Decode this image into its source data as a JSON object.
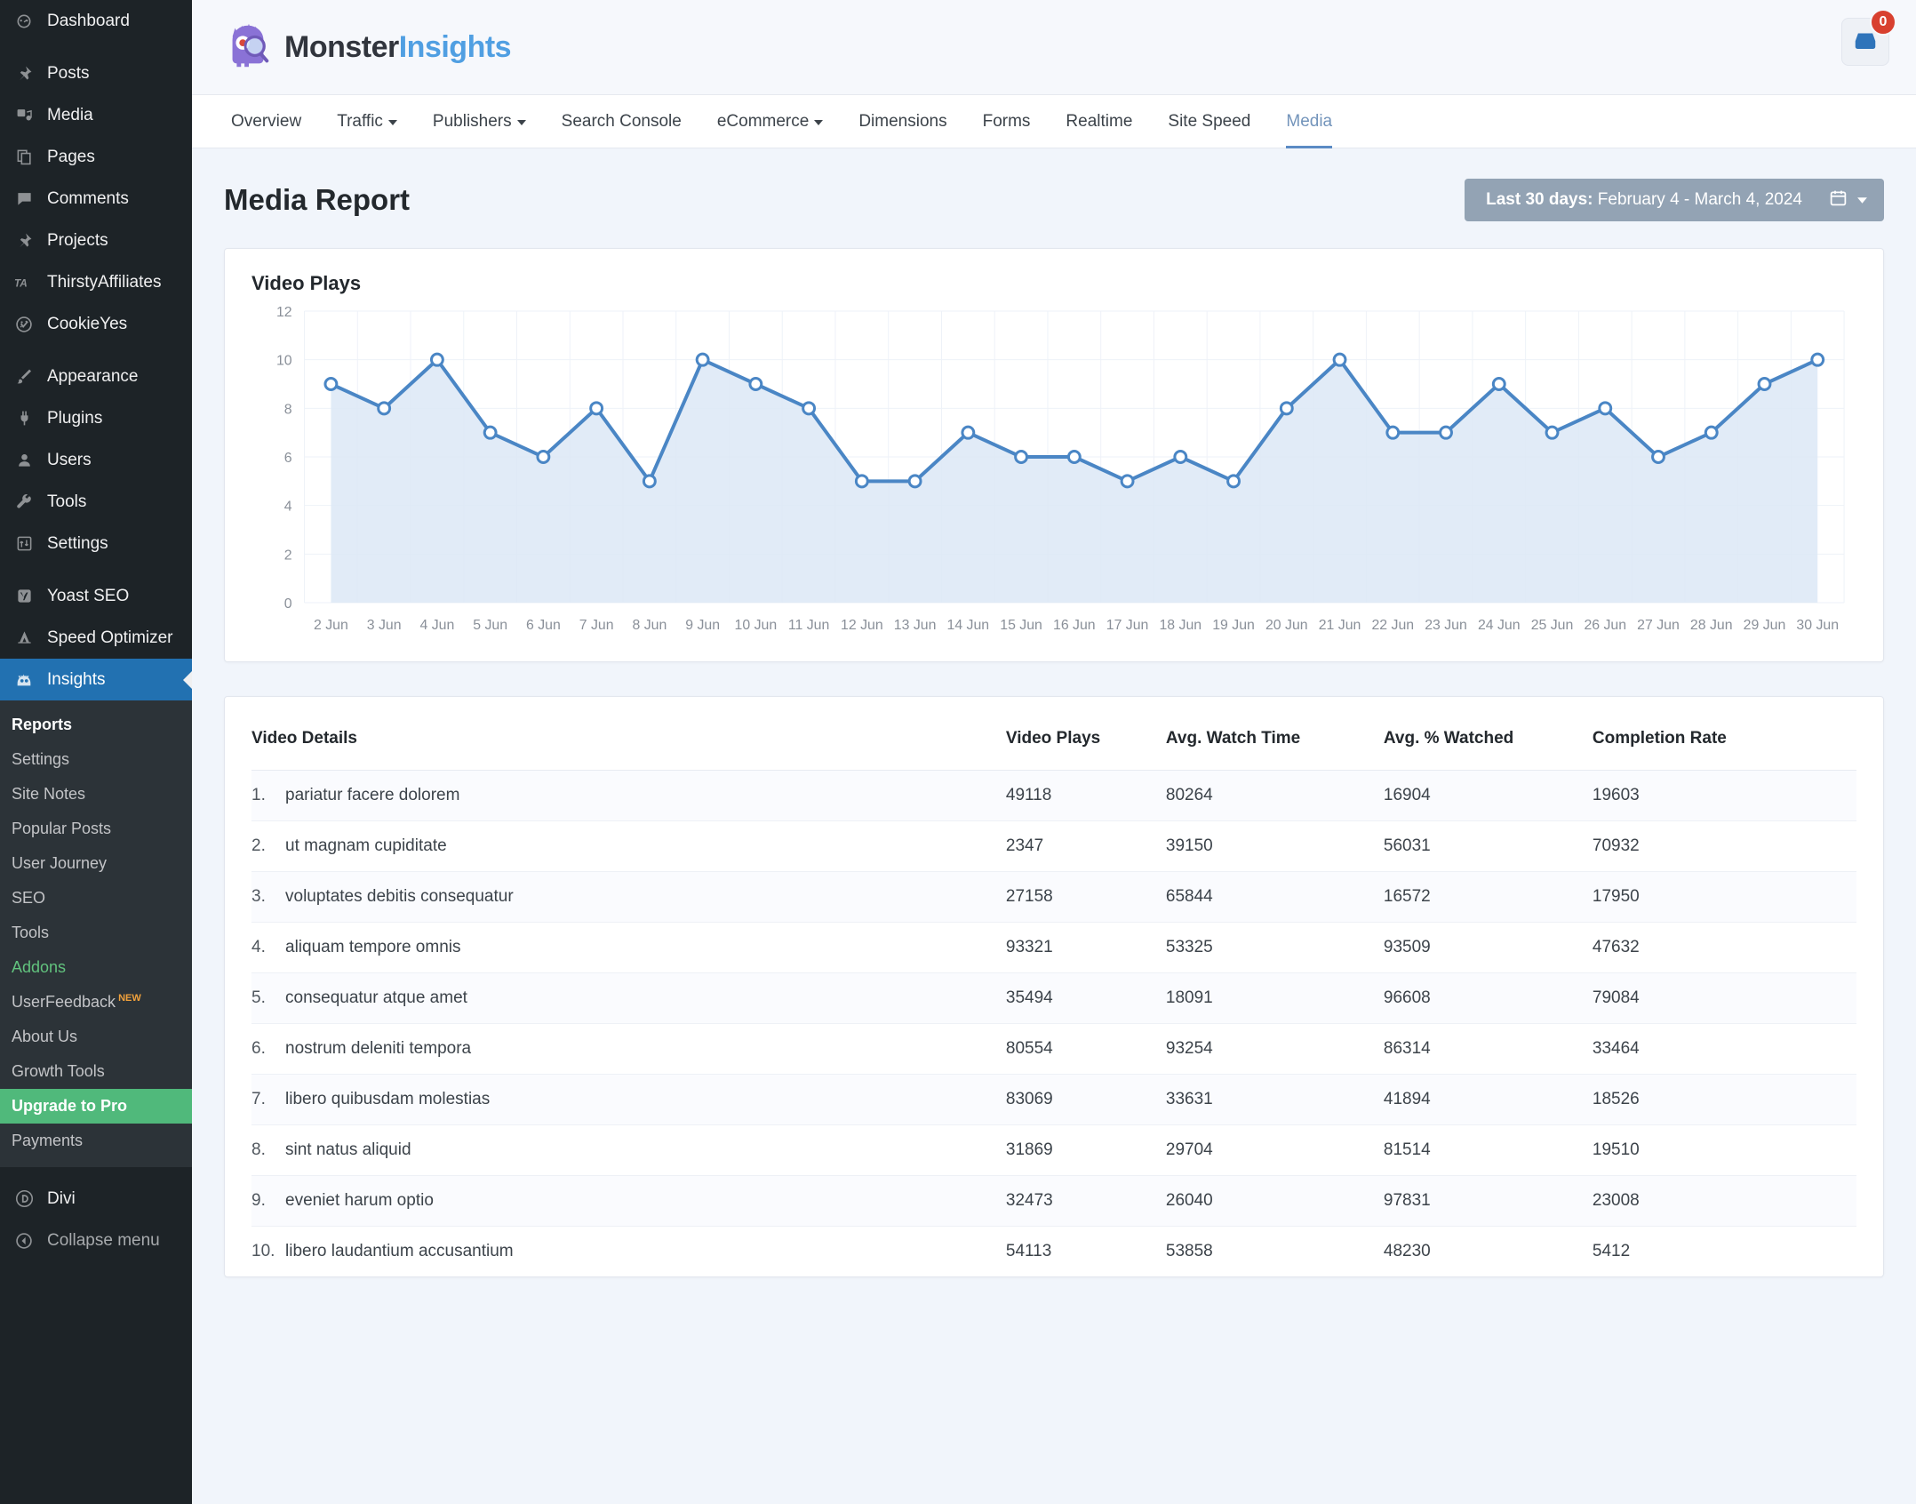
{
  "sidebar": {
    "groups": [
      {
        "items": [
          {
            "label": "Dashboard",
            "icon": "dashboard-icon"
          }
        ]
      },
      {
        "items": [
          {
            "label": "Posts",
            "icon": "pin-icon"
          },
          {
            "label": "Media",
            "icon": "media-icon"
          },
          {
            "label": "Pages",
            "icon": "pages-icon"
          },
          {
            "label": "Comments",
            "icon": "comment-icon"
          },
          {
            "label": "Projects",
            "icon": "pin-icon"
          },
          {
            "label": "ThirstyAffiliates",
            "icon": "thirstyaffiliates-icon"
          },
          {
            "label": "CookieYes",
            "icon": "cookieyes-icon"
          }
        ]
      },
      {
        "items": [
          {
            "label": "Appearance",
            "icon": "brush-icon"
          },
          {
            "label": "Plugins",
            "icon": "plug-icon"
          },
          {
            "label": "Users",
            "icon": "user-icon"
          },
          {
            "label": "Tools",
            "icon": "wrench-icon"
          },
          {
            "label": "Settings",
            "icon": "settings-icon"
          }
        ]
      },
      {
        "items": [
          {
            "label": "Yoast SEO",
            "icon": "yoast-icon"
          },
          {
            "label": "Speed Optimizer",
            "icon": "speed-icon"
          }
        ]
      }
    ],
    "active_item": {
      "label": "Insights",
      "icon": "monsterinsights-icon"
    },
    "submenu": [
      {
        "label": "Reports",
        "state": "current"
      },
      {
        "label": "Settings",
        "state": "normal"
      },
      {
        "label": "Site Notes",
        "state": "normal"
      },
      {
        "label": "Popular Posts",
        "state": "normal"
      },
      {
        "label": "User Journey",
        "state": "normal"
      },
      {
        "label": "SEO",
        "state": "normal"
      },
      {
        "label": "Tools",
        "state": "normal"
      },
      {
        "label": "Addons",
        "state": "green"
      },
      {
        "label": "UserFeedback",
        "state": "normal",
        "badge": "NEW"
      },
      {
        "label": "About Us",
        "state": "normal"
      },
      {
        "label": "Growth Tools",
        "state": "normal"
      },
      {
        "label": "Upgrade to Pro",
        "state": "pro"
      },
      {
        "label": "Payments",
        "state": "normal"
      }
    ],
    "footer_items": [
      {
        "label": "Divi",
        "icon": "divi-icon"
      },
      {
        "label": "Collapse menu",
        "icon": "collapse-icon"
      }
    ]
  },
  "header": {
    "logo_first": "Monster",
    "logo_second": "Insights",
    "notification_count": "0"
  },
  "nav": {
    "items": [
      {
        "label": "Overview",
        "dropdown": false,
        "active": false
      },
      {
        "label": "Traffic",
        "dropdown": true,
        "active": false
      },
      {
        "label": "Publishers",
        "dropdown": true,
        "active": false
      },
      {
        "label": "Search Console",
        "dropdown": false,
        "active": false
      },
      {
        "label": "eCommerce",
        "dropdown": true,
        "active": false
      },
      {
        "label": "Dimensions",
        "dropdown": false,
        "active": false
      },
      {
        "label": "Forms",
        "dropdown": false,
        "active": false
      },
      {
        "label": "Realtime",
        "dropdown": false,
        "active": false
      },
      {
        "label": "Site Speed",
        "dropdown": false,
        "active": false
      },
      {
        "label": "Media",
        "dropdown": false,
        "active": true
      }
    ]
  },
  "page": {
    "title": "Media Report",
    "date_range_prefix": "Last 30 days:",
    "date_range_value": "February 4 - March 4, 2024"
  },
  "chart_data": {
    "type": "area",
    "title": "Video Plays",
    "xlabel": "",
    "ylabel": "",
    "ylim": [
      0,
      12
    ],
    "yticks": [
      0,
      2,
      4,
      6,
      8,
      10,
      12
    ],
    "grid": true,
    "legend": "none",
    "categories": [
      "2 Jun",
      "3 Jun",
      "4 Jun",
      "5 Jun",
      "6 Jun",
      "7 Jun",
      "8 Jun",
      "9 Jun",
      "10 Jun",
      "11 Jun",
      "12 Jun",
      "13 Jun",
      "14 Jun",
      "15 Jun",
      "16 Jun",
      "17 Jun",
      "18 Jun",
      "19 Jun",
      "20 Jun",
      "21 Jun",
      "22 Jun",
      "23 Jun",
      "24 Jun",
      "25 Jun",
      "26 Jun",
      "27 Jun",
      "28 Jun",
      "29 Jun",
      "30 Jun"
    ],
    "values": [
      9,
      8,
      10,
      7,
      6,
      8,
      5,
      10,
      9,
      8,
      5,
      5,
      7,
      6,
      6,
      5,
      6,
      5,
      8,
      10,
      7,
      7,
      9,
      7,
      8,
      6,
      7,
      9,
      10
    ],
    "series": [
      {
        "name": "Video Plays",
        "values": [
          9,
          8,
          10,
          7,
          6,
          8,
          5,
          10,
          9,
          8,
          5,
          5,
          7,
          6,
          6,
          5,
          6,
          5,
          8,
          10,
          7,
          7,
          9,
          7,
          8,
          6,
          7,
          9,
          10
        ]
      }
    ],
    "line_color": "#4a86c5",
    "fill_color": "#dce8f6"
  },
  "table": {
    "columns": [
      "Video Details",
      "Video Plays",
      "Avg. Watch Time",
      "Avg. % Watched",
      "Completion Rate"
    ],
    "rows": [
      {
        "index": "1.",
        "name": "pariatur facere dolorem",
        "plays": "49118",
        "watch": "80264",
        "pct": "16904",
        "completion": "19603"
      },
      {
        "index": "2.",
        "name": "ut magnam cupiditate",
        "plays": "2347",
        "watch": "39150",
        "pct": "56031",
        "completion": "70932"
      },
      {
        "index": "3.",
        "name": "voluptates debitis consequatur",
        "plays": "27158",
        "watch": "65844",
        "pct": "16572",
        "completion": "17950"
      },
      {
        "index": "4.",
        "name": "aliquam tempore omnis",
        "plays": "93321",
        "watch": "53325",
        "pct": "93509",
        "completion": "47632"
      },
      {
        "index": "5.",
        "name": "consequatur atque amet",
        "plays": "35494",
        "watch": "18091",
        "pct": "96608",
        "completion": "79084"
      },
      {
        "index": "6.",
        "name": "nostrum deleniti tempora",
        "plays": "80554",
        "watch": "93254",
        "pct": "86314",
        "completion": "33464"
      },
      {
        "index": "7.",
        "name": "libero quibusdam molestias",
        "plays": "83069",
        "watch": "33631",
        "pct": "41894",
        "completion": "18526"
      },
      {
        "index": "8.",
        "name": "sint natus aliquid",
        "plays": "31869",
        "watch": "29704",
        "pct": "81514",
        "completion": "19510"
      },
      {
        "index": "9.",
        "name": "eveniet harum optio",
        "plays": "32473",
        "watch": "26040",
        "pct": "97831",
        "completion": "23008"
      },
      {
        "index": "10.",
        "name": "libero laudantium accusantium",
        "plays": "54113",
        "watch": "53858",
        "pct": "48230",
        "completion": "5412"
      }
    ]
  }
}
